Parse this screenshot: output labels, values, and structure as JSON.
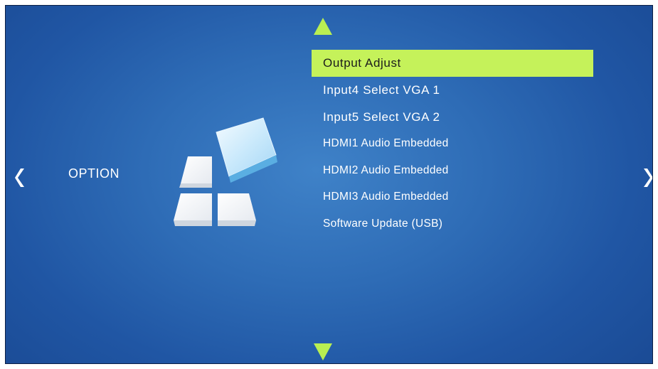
{
  "screen": {
    "section_label": "OPTION"
  },
  "navigation": {
    "left_icon": "chevron-left-icon",
    "right_icon": "chevron-right-icon",
    "up_icon": "triangle-up-icon",
    "down_icon": "triangle-down-icon"
  },
  "menu": {
    "selected_index": 0,
    "items": [
      {
        "label": "Output Adjust"
      },
      {
        "label": "Input4 Select VGA 1"
      },
      {
        "label": "Input5 Select VGA 2"
      },
      {
        "label": "HDMI1 Audio Embedded"
      },
      {
        "label": "HDMI2 Audio Embedded"
      },
      {
        "label": "HDMI3 Audio Embedded"
      },
      {
        "label": "Software Update (USB)"
      }
    ]
  },
  "colors": {
    "background": "#2e6cb6",
    "highlight": "#c5f25a",
    "arrow_green": "#b9ef52",
    "text": "#ffffff"
  }
}
